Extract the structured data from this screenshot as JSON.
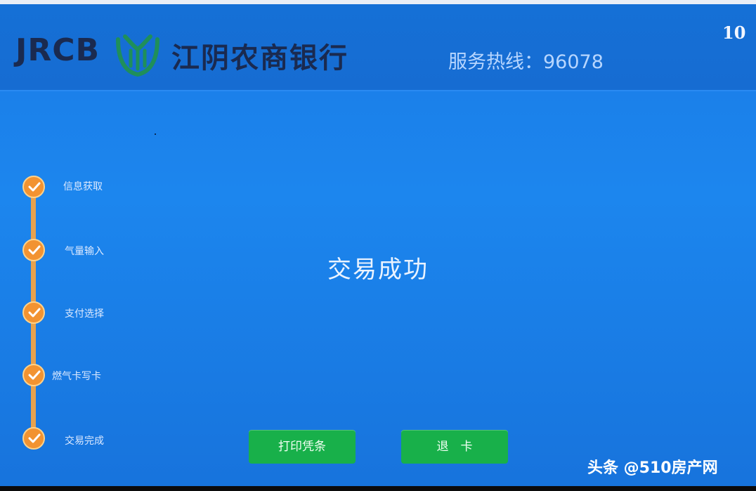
{
  "header": {
    "brand_latin": "JRCB",
    "brand_name": "江阴农商银行",
    "hotline": "服务热线：96078",
    "countdown": "10"
  },
  "steps": [
    {
      "label": "信息获取",
      "status": "done"
    },
    {
      "label": "气量输入",
      "status": "done"
    },
    {
      "label": "支付选择",
      "status": "done"
    },
    {
      "label": "燃气卡写卡",
      "status": "done"
    },
    {
      "label": "交易完成",
      "status": "done"
    }
  ],
  "main": {
    "status_message": "交易成功"
  },
  "actions": {
    "print_receipt": "打印凭条",
    "eject_card": "退　卡"
  },
  "watermark": "头条 @510房产网",
  "colors": {
    "background": "#1c86ee",
    "header": "#1570d6",
    "step_accent": "#f29331",
    "button": "#18b04a"
  }
}
